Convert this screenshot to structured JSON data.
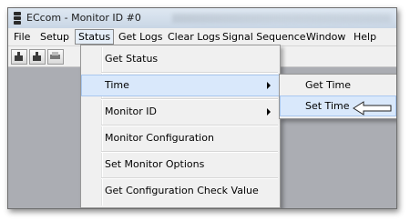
{
  "window": {
    "title": "ECcom - Monitor ID #0"
  },
  "menubar": {
    "items": [
      "File",
      "Setup",
      "Status",
      "Get Logs",
      "Clear Logs",
      "Signal Sequence",
      "Window",
      "Help"
    ],
    "active": "Status"
  },
  "toolbar": {
    "buttons": [
      "open-icon",
      "save-icon",
      "print-icon"
    ]
  },
  "status_menu": {
    "items": [
      {
        "label": "Get Status",
        "submenu": false
      },
      {
        "label": "Time",
        "submenu": true,
        "highlighted": true
      },
      {
        "label": "Monitor ID",
        "submenu": true
      },
      {
        "label": "Monitor Configuration",
        "submenu": false
      },
      {
        "label": "Set Monitor Options",
        "submenu": false
      },
      {
        "label": "Get Configuration Check Value",
        "submenu": false
      }
    ]
  },
  "time_submenu": {
    "items": [
      {
        "label": "Get Time"
      },
      {
        "label": "Set Time",
        "highlighted": true
      }
    ]
  },
  "colors": {
    "client_area": "#abadb3",
    "highlight": "#d9e8fb",
    "menu_bg": "#f0f0f0"
  }
}
